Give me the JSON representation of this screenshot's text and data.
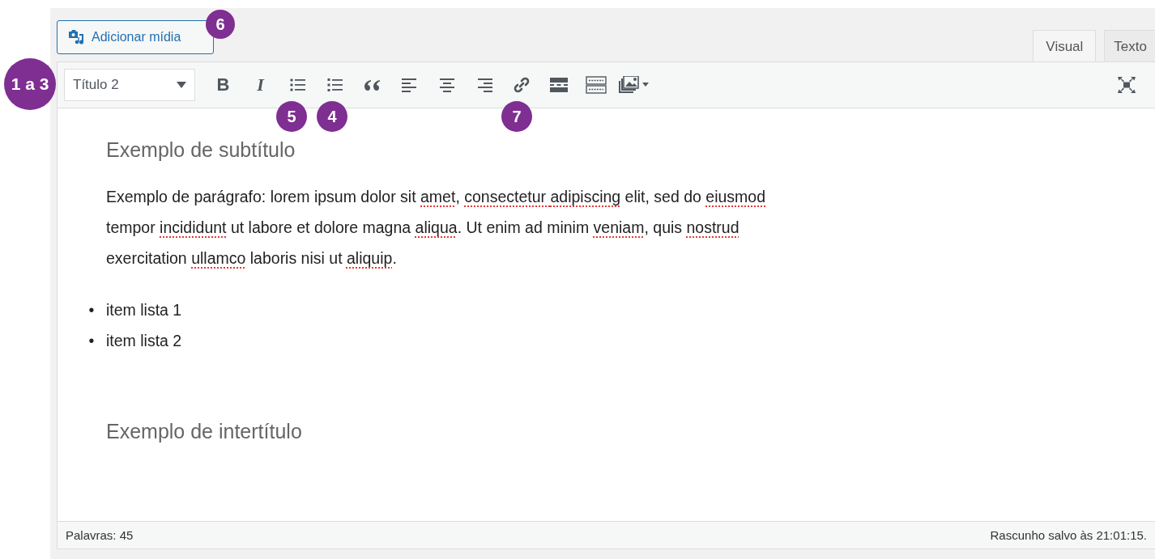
{
  "media_button": {
    "label": "Adicionar mídia"
  },
  "tabs": [
    {
      "label": "Visual",
      "selected": true
    },
    {
      "label": "Texto",
      "selected": false
    }
  ],
  "toolbar": {
    "format_select": {
      "value": "Título 2"
    },
    "buttons": [
      {
        "kind": "bold",
        "label": "B"
      },
      {
        "kind": "italic",
        "label": "I"
      },
      {
        "kind": "bullet-list"
      },
      {
        "kind": "numbered-list"
      },
      {
        "kind": "blockquote"
      },
      {
        "kind": "align-left"
      },
      {
        "kind": "align-center"
      },
      {
        "kind": "align-right"
      },
      {
        "kind": "link"
      },
      {
        "kind": "read-more"
      },
      {
        "kind": "toolbar-toggle"
      },
      {
        "kind": "gallery"
      }
    ],
    "fullscreen": true
  },
  "content": [
    {
      "kind": "heading",
      "text": "Exemplo de subtítulo"
    },
    {
      "kind": "paragraph",
      "segments": [
        {
          "text": "Exemplo de parágrafo: lorem ipsum dolor sit ",
          "misspelled": false
        },
        {
          "text": "amet",
          "misspelled": true
        },
        {
          "text": ", ",
          "misspelled": false
        },
        {
          "text": "consectetur ",
          "misspelled": true
        },
        {
          "text": "adipiscing",
          "misspelled": true
        },
        {
          "text": " elit, sed do ",
          "misspelled": false
        },
        {
          "text": "eiusmod",
          "misspelled": true
        },
        {
          "text": " tempor ",
          "misspelled": false
        },
        {
          "text": "incididunt",
          "misspelled": true
        },
        {
          "text": " ut labore et dolore magna ",
          "misspelled": false
        },
        {
          "text": "aliqua",
          "misspelled": true
        },
        {
          "text": ". Ut enim ad minim ",
          "misspelled": false
        },
        {
          "text": "veniam",
          "misspelled": true
        },
        {
          "text": ", quis ",
          "misspelled": false
        },
        {
          "text": "nostrud",
          "misspelled": true
        },
        {
          "text": " exercitation ",
          "misspelled": false
        },
        {
          "text": "ullamco",
          "misspelled": true
        },
        {
          "text": " laboris nisi ut ",
          "misspelled": false
        },
        {
          "text": "aliquip",
          "misspelled": true
        },
        {
          "text": ".",
          "misspelled": false
        }
      ]
    },
    {
      "kind": "list",
      "items": [
        {
          "marker": "•",
          "text": "item lista 1"
        },
        {
          "marker": "•",
          "text": "item lista 2"
        }
      ]
    },
    {
      "kind": "heading",
      "text": "Exemplo de intertítulo"
    }
  ],
  "status_bar": {
    "word_count": "Palavras: 45",
    "saved": "Rascunho salvo às 21:01:15."
  },
  "annotations": [
    {
      "label": "1 a 3"
    },
    {
      "label": "6"
    },
    {
      "label": "5"
    },
    {
      "label": "4"
    },
    {
      "label": "7"
    }
  ]
}
